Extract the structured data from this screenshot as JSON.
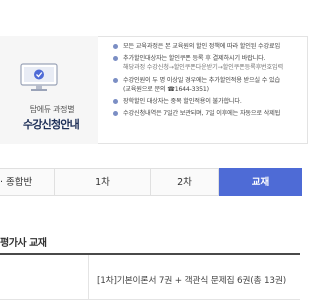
{
  "notice": {
    "subtitle": "탑에듀 과정별",
    "title": "수강신청안내",
    "items": [
      "모든 교육과정은 본 교육원의 할인 정책에 따라 할인된 수강료입",
      "추가할인대상자는 할인쿠폰 등록 후 결제하시기 바랍니다.",
      "해당과정 수강신청→할인쿠폰다운받기→할인쿠폰등록후번호입력",
      "수강인원이 두 명 이상일 경우에는 추가할인적용 받으실 수 있습",
      "(교육원으로 문의 ☎1644-3351)",
      "장학할인 대상자는 중복 할인적용이 불가합니다.",
      "수강신청내역은 7일간 보관되며, 7일 이후에는 자동으로 삭제됩"
    ]
  },
  "tabs": {
    "first": "· 종합반",
    "items": [
      "1차",
      "2차"
    ],
    "active": "교재"
  },
  "section": {
    "title": "평가사 교재"
  },
  "table": {
    "rows": [
      {
        "name": "[1차]기본이론서 7권 + 객관식 문제집 6권(총 13권)"
      }
    ]
  },
  "colors": {
    "accent": "#4e6bd6",
    "title": "#1d2f58"
  }
}
